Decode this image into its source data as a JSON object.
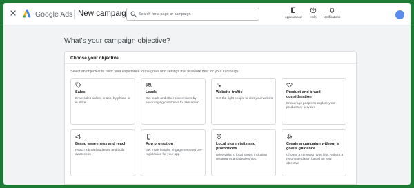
{
  "topbar": {
    "brand": "Google Ads",
    "page_title": "New campaign",
    "search_placeholder": "Search for a page or campaign",
    "actions": [
      {
        "label": "Appearance",
        "icon": "appearance-icon"
      },
      {
        "label": "Help",
        "icon": "help-icon"
      },
      {
        "label": "Notifications",
        "icon": "bell-icon"
      }
    ]
  },
  "main": {
    "heading": "What's your campaign objective?",
    "panel_title": "Choose your objective",
    "panel_subtitle": "Select an objective to tailor your experience to the goals and settings that will work best for your campaign",
    "objectives": [
      {
        "title": "Sales",
        "description": "Drive sales online, in app, by phone or in store",
        "icon": "tag-icon"
      },
      {
        "title": "Leads",
        "description": "Get leads and other conversions by encouraging customers to take action",
        "icon": "people-icon"
      },
      {
        "title": "Website traffic",
        "description": "Get the right people to visit your website",
        "icon": "cursor-click-icon"
      },
      {
        "title": "Product and brand consideration",
        "description": "Encourage people to explore your products or services",
        "icon": "heart-icon"
      },
      {
        "title": "Brand awareness and reach",
        "description": "Reach a broad audience and build awareness",
        "icon": "megaphone-icon"
      },
      {
        "title": "App promotion",
        "description": "Get more installs, engagement and pre-registration for your app",
        "icon": "phone-icon"
      },
      {
        "title": "Local store visits and promotions",
        "description": "Drive visits to local shops, including restaurants and dealerships.",
        "icon": "location-pin-icon"
      },
      {
        "title": "Create a campaign without a goal's guidance",
        "description": "Choose a campaign type first, without a recommendation based on your objective",
        "icon": "settings-gear-icon"
      }
    ]
  },
  "colors": {
    "background": "#1c7a35",
    "accent_blue": "#4285f4",
    "accent_green": "#34a853",
    "accent_yellow": "#fbbc04",
    "avatar": "#5b8def"
  }
}
